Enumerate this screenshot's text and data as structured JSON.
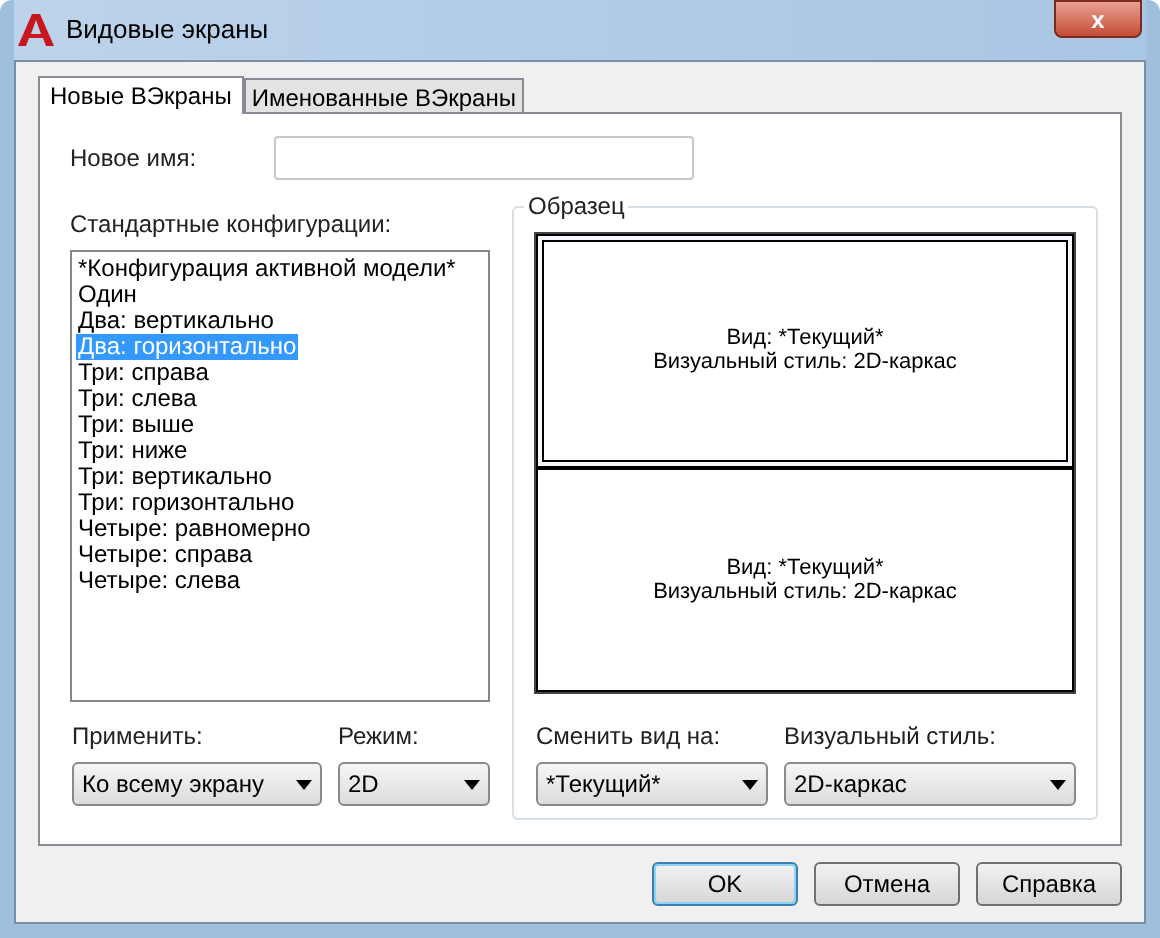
{
  "window": {
    "title": "Видовые экраны",
    "close": "x"
  },
  "tabs": [
    {
      "label": "Новые ВЭкраны",
      "selected": true
    },
    {
      "label": "Именованные ВЭкраны",
      "selected": false
    }
  ],
  "new_name": {
    "label": "Новое имя:"
  },
  "configurations": {
    "label": "Стандартные конфигурации:",
    "items": [
      {
        "label": "*Конфигурация активной модели*",
        "selected": false
      },
      {
        "label": "Один",
        "selected": false
      },
      {
        "label": "Два: вертикально",
        "selected": false
      },
      {
        "label": "Два: горизонтально",
        "selected": true
      },
      {
        "label": "Три: справа",
        "selected": false
      },
      {
        "label": "Три: слева",
        "selected": false
      },
      {
        "label": "Три: выше",
        "selected": false
      },
      {
        "label": "Три: ниже",
        "selected": false
      },
      {
        "label": "Три: вертикально",
        "selected": false
      },
      {
        "label": "Три: горизонтально",
        "selected": false
      },
      {
        "label": "Четыре: равномерно",
        "selected": false
      },
      {
        "label": "Четыре: справа",
        "selected": false
      },
      {
        "label": "Четыре: слева",
        "selected": false
      }
    ]
  },
  "preview": {
    "title": "Образец",
    "panes": [
      {
        "view": "Вид: *Текущий*",
        "style": "Визуальный стиль: 2D-каркас",
        "selected": true
      },
      {
        "view": "Вид: *Текущий*",
        "style": "Визуальный стиль: 2D-каркас",
        "selected": false
      }
    ]
  },
  "dropdowns": [
    {
      "label": "Применить:",
      "value": "Ко всему экрану"
    },
    {
      "label": "Режим:",
      "value": "2D"
    },
    {
      "label": "Сменить вид на:",
      "value": "*Текущий*"
    },
    {
      "label": "Визуальный стиль:",
      "value": "2D-каркас"
    }
  ],
  "buttons": [
    {
      "label": "OK",
      "default": true
    },
    {
      "label": "Отмена",
      "default": false
    },
    {
      "label": "Справка",
      "default": false
    }
  ]
}
